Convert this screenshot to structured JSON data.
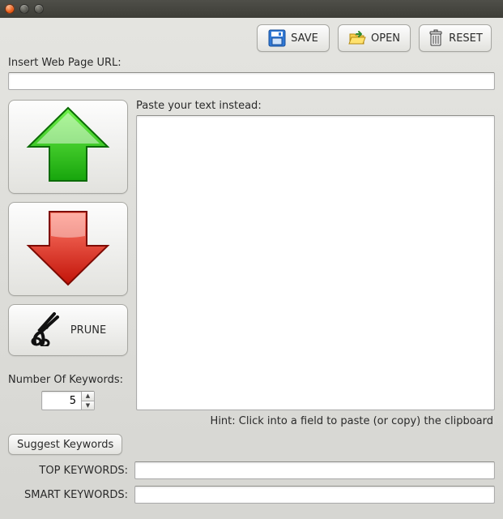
{
  "window": {
    "controls": {
      "close": "close",
      "minimize": "minimize",
      "maximize": "maximize"
    }
  },
  "toolbar": {
    "save_label": "SAVE",
    "open_label": "OPEN",
    "reset_label": "RESET"
  },
  "url_section": {
    "label": "Insert Web Page URL:",
    "value": ""
  },
  "text_section": {
    "label": "Paste your text instead:",
    "value": ""
  },
  "left_buttons": {
    "up": "move-up",
    "down": "move-down",
    "prune_label": "PRUNE"
  },
  "num_keywords": {
    "label": "Number Of Keywords:",
    "value": "5"
  },
  "suggest_button_label": "Suggest Keywords",
  "hint": "Hint: Click into a field to paste (or copy) the clipboard",
  "top_keywords": {
    "label": "TOP KEYWORDS:",
    "value": ""
  },
  "smart_keywords": {
    "label": "SMART KEYWORDS:",
    "value": ""
  },
  "icons": {
    "save": "floppy-disk-icon",
    "open": "folder-open-icon",
    "reset": "trash-icon",
    "prune": "shears-icon"
  }
}
